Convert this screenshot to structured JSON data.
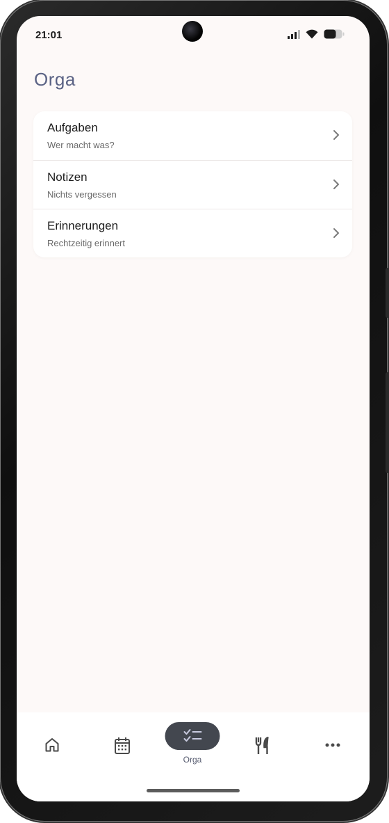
{
  "status_bar": {
    "time": "21:01"
  },
  "page": {
    "title": "Orga"
  },
  "menu": {
    "items": [
      {
        "title": "Aufgaben",
        "subtitle": "Wer macht was?"
      },
      {
        "title": "Notizen",
        "subtitle": "Nichts vergessen"
      },
      {
        "title": "Erinnerungen",
        "subtitle": "Rechtzeitig erinnert"
      }
    ]
  },
  "bottom_nav": {
    "items": [
      {
        "icon": "home-icon",
        "label": ""
      },
      {
        "icon": "calendar-icon",
        "label": ""
      },
      {
        "icon": "checklist-icon",
        "label": "Orga",
        "active": true
      },
      {
        "icon": "utensils-icon",
        "label": ""
      },
      {
        "icon": "more-icon",
        "label": ""
      }
    ]
  },
  "colors": {
    "background": "#fdf9f8",
    "title": "#5a6284",
    "active_pill": "#43474f",
    "card": "#ffffff"
  }
}
